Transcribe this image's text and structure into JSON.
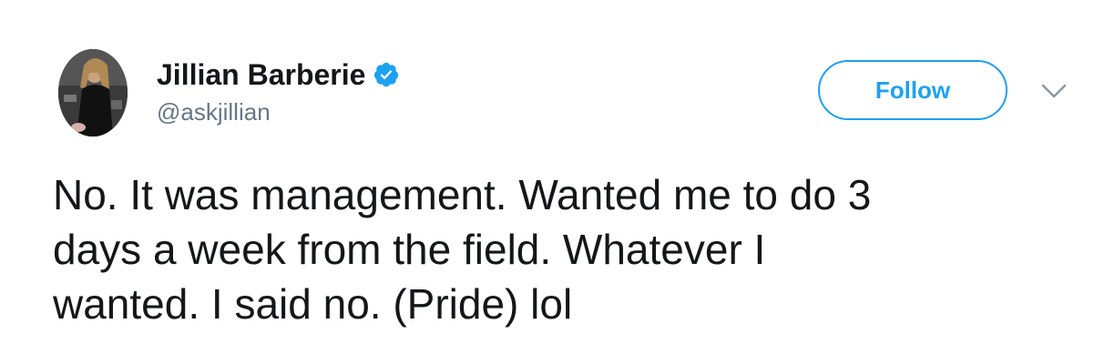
{
  "author": {
    "display_name": "Jillian Barberie",
    "handle": "@askjillian",
    "verified": true,
    "verified_icon": "verified-badge-icon"
  },
  "actions": {
    "follow_label": "Follow",
    "more_icon": "chevron-down-icon"
  },
  "tweet": {
    "text": "No. It was management. Wanted me to do 3\ndays a week from the field. Whatever I\nwanted. I said no. (Pride) lol"
  },
  "colors": {
    "accent": "#1da1f2",
    "text": "#14171a",
    "secondary_text": "#657786"
  }
}
